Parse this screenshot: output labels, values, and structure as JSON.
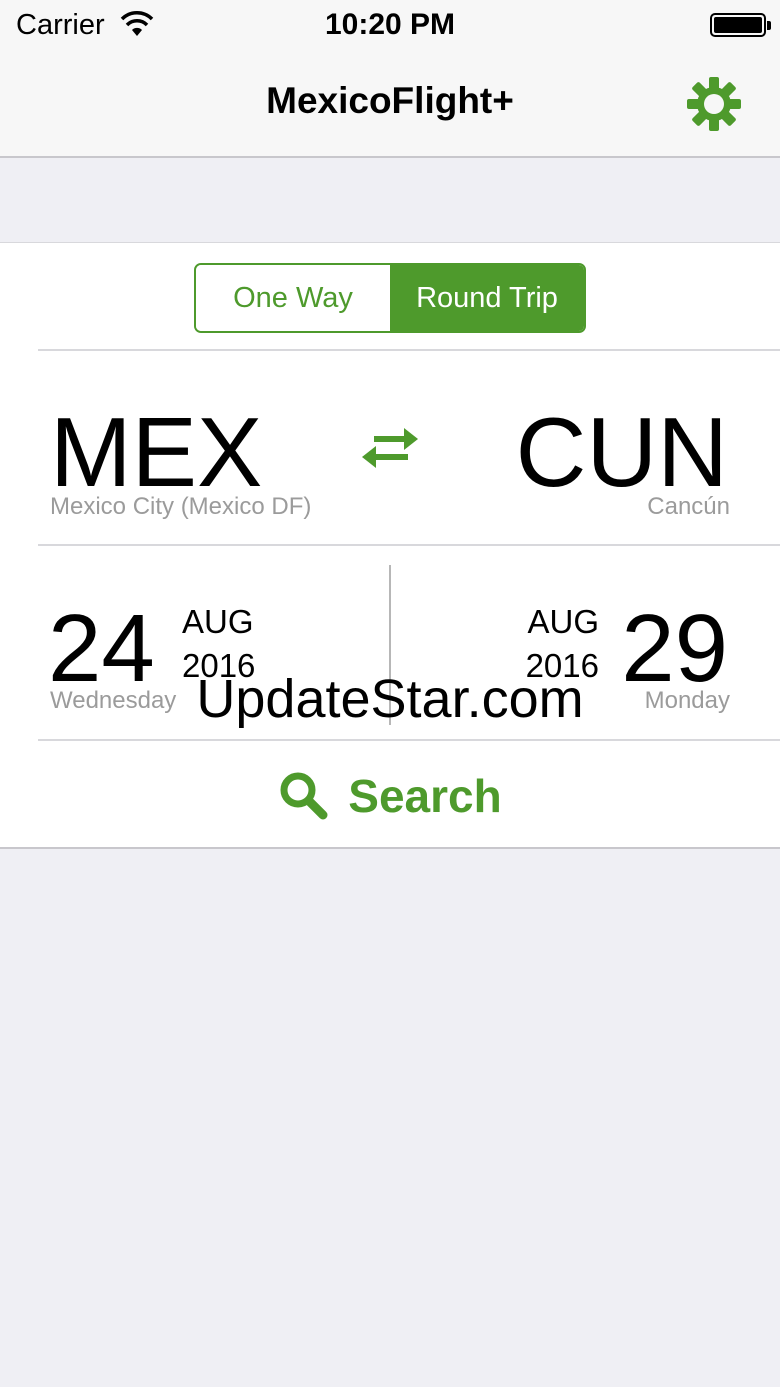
{
  "status_bar": {
    "carrier": "Carrier",
    "time": "10:20 PM"
  },
  "nav": {
    "title": "MexicoFlight+",
    "settings_icon": "gear-icon"
  },
  "trip_type": {
    "options": [
      "One Way",
      "Round Trip"
    ],
    "selected": "Round Trip"
  },
  "origin": {
    "code": "MEX",
    "city": "Mexico City (Mexico DF)"
  },
  "destination": {
    "code": "CUN",
    "city": "Cancún"
  },
  "swap_icon": "swap-arrows-icon",
  "departure": {
    "day": "24",
    "month": "AUG",
    "year": "2016",
    "weekday": "Wednesday"
  },
  "return": {
    "day": "29",
    "month": "AUG",
    "year": "2016",
    "weekday": "Monday"
  },
  "search": {
    "label": "Search",
    "icon": "search-icon"
  },
  "watermark": "UpdateStar.com",
  "colors": {
    "accent": "#4e9a2c",
    "background": "#efeff4",
    "secondary_text": "#9b9b9b"
  }
}
